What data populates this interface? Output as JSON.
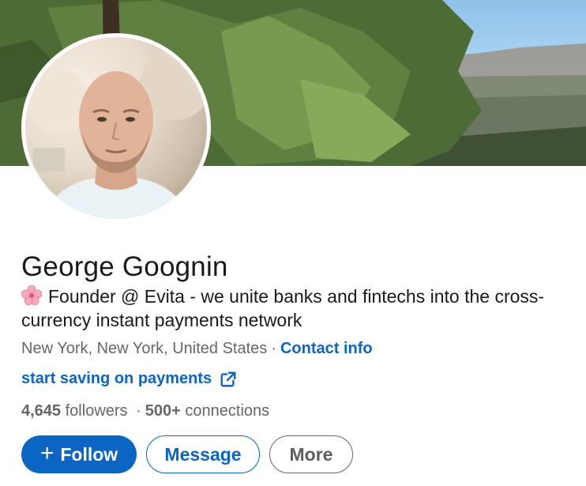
{
  "profile": {
    "name": "George Goognin",
    "headline_emoji": "cherry-blossom-icon",
    "headline": "Founder @ Evita - we unite banks and fintechs into the cross-currency instant payments network",
    "location": "New York, New York, United States",
    "separator": "·",
    "contact_label": "Contact info",
    "website_label": "start saving on payments",
    "followers_count": "4,645",
    "followers_label": "followers",
    "connections_count": "500+",
    "connections_label": "connections"
  },
  "actions": {
    "follow_icon": "+",
    "follow_label": "Follow",
    "message_label": "Message",
    "more_label": "More"
  },
  "colors": {
    "accent": "#0a66c2",
    "secondary_text": "#666666",
    "primary_text": "#191919"
  }
}
